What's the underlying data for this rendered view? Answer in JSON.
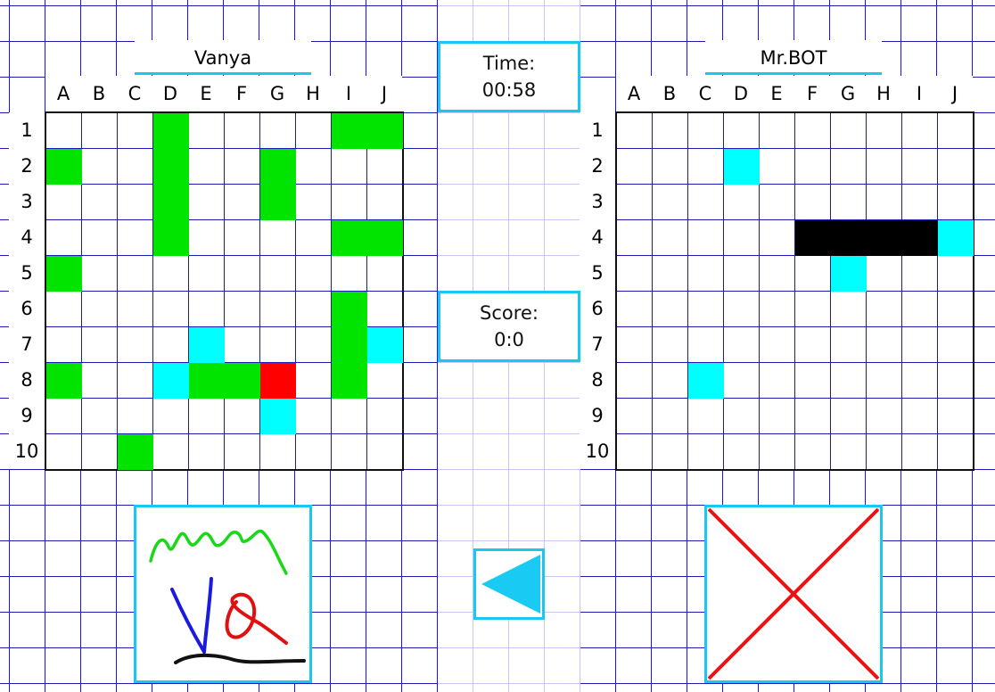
{
  "player": {
    "name": "Vanya",
    "avatar_icon": "scribble-drawing-icon",
    "cells": [
      {
        "col": "D",
        "row": 1,
        "state": "ship"
      },
      {
        "col": "I",
        "row": 1,
        "state": "ship"
      },
      {
        "col": "J",
        "row": 1,
        "state": "ship"
      },
      {
        "col": "A",
        "row": 2,
        "state": "ship"
      },
      {
        "col": "D",
        "row": 2,
        "state": "ship"
      },
      {
        "col": "G",
        "row": 2,
        "state": "ship"
      },
      {
        "col": "D",
        "row": 3,
        "state": "ship"
      },
      {
        "col": "G",
        "row": 3,
        "state": "ship"
      },
      {
        "col": "D",
        "row": 4,
        "state": "ship"
      },
      {
        "col": "I",
        "row": 4,
        "state": "ship"
      },
      {
        "col": "J",
        "row": 4,
        "state": "ship"
      },
      {
        "col": "A",
        "row": 5,
        "state": "ship"
      },
      {
        "col": "I",
        "row": 6,
        "state": "ship"
      },
      {
        "col": "E",
        "row": 7,
        "state": "miss"
      },
      {
        "col": "I",
        "row": 7,
        "state": "ship"
      },
      {
        "col": "J",
        "row": 7,
        "state": "miss"
      },
      {
        "col": "A",
        "row": 8,
        "state": "ship"
      },
      {
        "col": "D",
        "row": 8,
        "state": "miss"
      },
      {
        "col": "E",
        "row": 8,
        "state": "ship"
      },
      {
        "col": "F",
        "row": 8,
        "state": "ship"
      },
      {
        "col": "G",
        "row": 8,
        "state": "hit"
      },
      {
        "col": "I",
        "row": 8,
        "state": "ship"
      },
      {
        "col": "G",
        "row": 9,
        "state": "miss"
      },
      {
        "col": "C",
        "row": 10,
        "state": "ship"
      }
    ]
  },
  "opponent": {
    "name": "Mr.BOT",
    "avatar_icon": "red-cross-icon",
    "cells": [
      {
        "col": "D",
        "row": 2,
        "state": "miss"
      },
      {
        "col": "F",
        "row": 4,
        "state": "sunk"
      },
      {
        "col": "G",
        "row": 4,
        "state": "sunk"
      },
      {
        "col": "H",
        "row": 4,
        "state": "sunk"
      },
      {
        "col": "I",
        "row": 4,
        "state": "sunk"
      },
      {
        "col": "J",
        "row": 4,
        "state": "miss"
      },
      {
        "col": "G",
        "row": 5,
        "state": "miss"
      },
      {
        "col": "C",
        "row": 8,
        "state": "miss"
      }
    ]
  },
  "columns": [
    "A",
    "B",
    "C",
    "D",
    "E",
    "F",
    "G",
    "H",
    "I",
    "J"
  ],
  "rows": [
    "1",
    "2",
    "3",
    "4",
    "5",
    "6",
    "7",
    "8",
    "9",
    "10"
  ],
  "time": {
    "label": "Time:",
    "value": "00:58"
  },
  "score": {
    "label": "Score:",
    "value": "0:0"
  },
  "back_button": {
    "icon": "back-arrow-icon"
  },
  "colors": {
    "ship": "#00e400",
    "miss": "#00ffff",
    "hit": "#ff0000",
    "sunk": "#000000",
    "accent": "#19c8f0",
    "grid_line": "#1c1cb4"
  }
}
